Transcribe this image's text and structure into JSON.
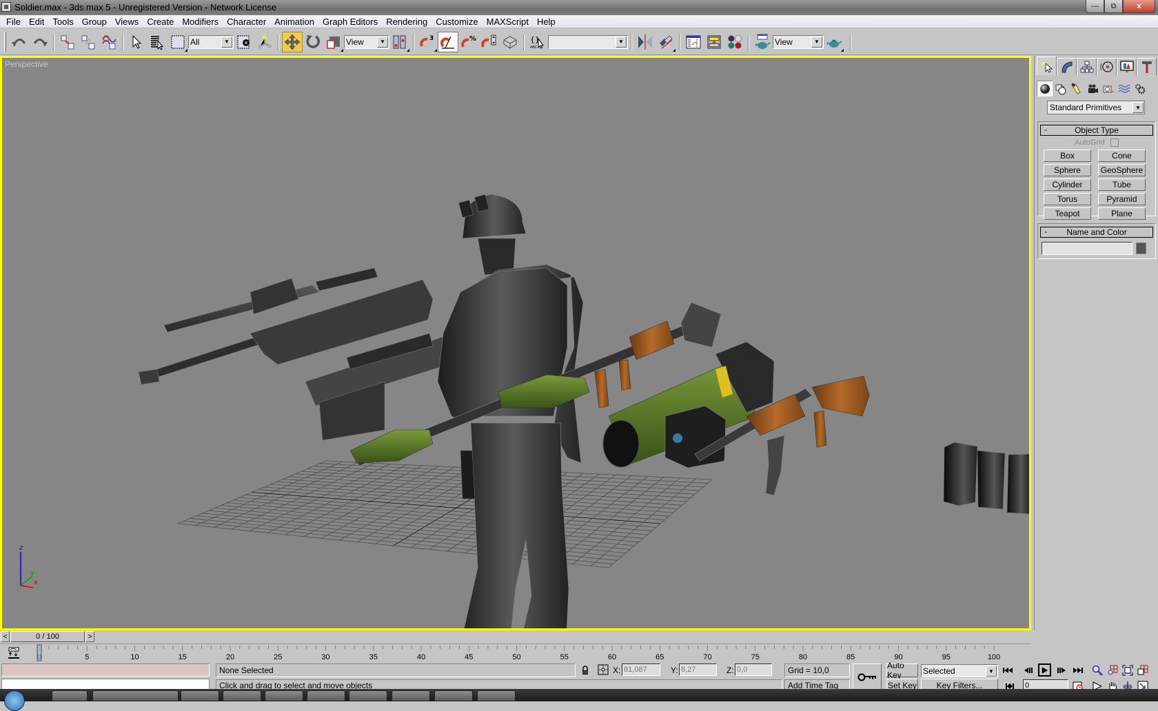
{
  "window": {
    "title": "Soldier.max - 3ds max 5 - Unregistered Version - Network License",
    "minimize_icon": "minimize-icon",
    "maximize_icon": "restore-icon",
    "close_icon": "close-icon",
    "close_label": "x",
    "min_label": "—",
    "max_label": "⧉"
  },
  "menu": [
    "File",
    "Edit",
    "Tools",
    "Group",
    "Views",
    "Create",
    "Modifiers",
    "Character",
    "Animation",
    "Graph Editors",
    "Rendering",
    "Customize",
    "MAXScript",
    "Help"
  ],
  "toolbar": {
    "selection_filter": "All",
    "reference_coord": "View",
    "named_selection": "",
    "render_type": "View",
    "buttons": [
      "undo",
      "redo",
      "select-and-link",
      "unlink-selection",
      "bind-to-space-warp",
      "select-object",
      "select-by-name",
      "rectangular-selection-region",
      "window-crossing",
      "selection-center",
      "select-and-move",
      "select-and-rotate",
      "select-and-scale",
      "use-pivot-point",
      "3d-snap-toggle",
      "angle-snap-toggle",
      "percent-snap-toggle",
      "spinner-snap-toggle",
      "named-selection-sets",
      "edit-named-selections",
      "mirror",
      "align",
      "track-view",
      "schematic-view",
      "material-editor",
      "render-scene",
      "quick-render"
    ],
    "active_tool": "select-and-move",
    "pressed_tool": "angle-snap-toggle"
  },
  "viewport": {
    "label": "Perspective",
    "border_color": "#ffff00",
    "background": "#868686",
    "axis_labels": {
      "x": "x",
      "y": "y",
      "z": "z"
    }
  },
  "command_panel": {
    "tabs": [
      "create",
      "modify",
      "hierarchy",
      "motion",
      "display",
      "utilities"
    ],
    "active_tab": "create",
    "subcategories": [
      "geometry",
      "shapes",
      "lights",
      "cameras",
      "helpers",
      "space-warps",
      "systems"
    ],
    "active_subcategory": "geometry",
    "category_dropdown": "Standard Primitives",
    "object_type": {
      "title": "Object Type",
      "collapse": "-",
      "autogrid_label": "AutoGrid",
      "autogrid_checked": false,
      "buttons": [
        "Box",
        "Cone",
        "Sphere",
        "GeoSphere",
        "Cylinder",
        "Tube",
        "Torus",
        "Pyramid",
        "Teapot",
        "Plane"
      ]
    },
    "name_and_color": {
      "title": "Name and Color",
      "collapse": "-",
      "name_value": "",
      "color": "#555555"
    }
  },
  "time_slider": {
    "position": "0 / 100",
    "prev": "<",
    "next": ">",
    "current_frame": 0,
    "total_frames": 100
  },
  "trackbar": {
    "ticks": [
      "0",
      "5",
      "10",
      "15",
      "20",
      "25",
      "30",
      "35",
      "40",
      "45",
      "50",
      "55",
      "60",
      "65",
      "70",
      "75",
      "80",
      "85",
      "90",
      "95",
      "100"
    ]
  },
  "status": {
    "selection": "None Selected",
    "prompt": "Click and drag to select and move objects",
    "x_label": "X:",
    "y_label": "Y:",
    "z_label": "Z:",
    "x_value": "81,087",
    "y_value": "8,27",
    "z_value": "0,0",
    "grid": "Grid = 10,0",
    "add_time_tag": "Add Time Tag",
    "auto_key": "Auto Key",
    "set_key": "Set Key",
    "key_mode": "Selected",
    "key_filters": "Key Filters...",
    "frame_value": "0"
  }
}
